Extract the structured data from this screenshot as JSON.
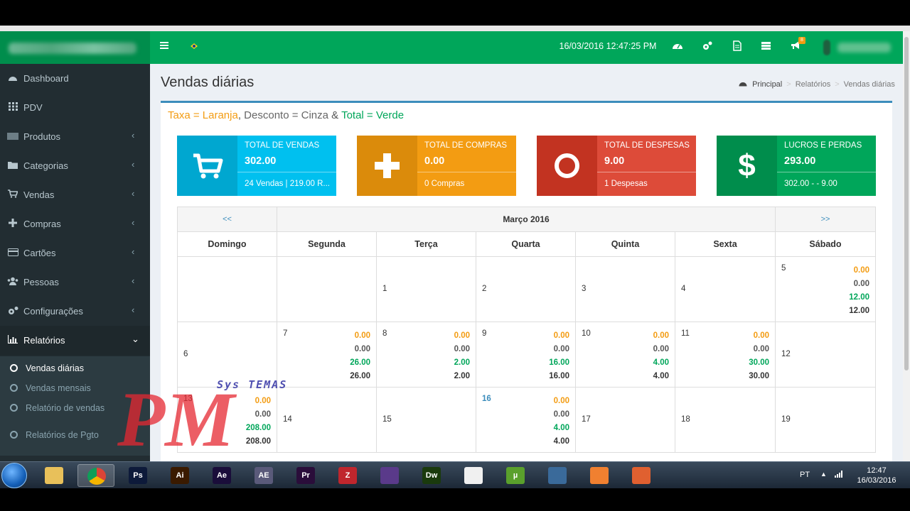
{
  "header": {
    "datetime": "16/03/2016 12:47:25 PM",
    "menu_icon": "hamburger-menu-icon",
    "flag_icon": "brazil-flag-icon",
    "notification_count": "8"
  },
  "sidebar": {
    "items": [
      {
        "label": "Dashboard",
        "icon": "dashboard-icon"
      },
      {
        "label": "PDV",
        "icon": "grid-icon"
      },
      {
        "label": "Produtos",
        "icon": "product-icon"
      },
      {
        "label": "Categorias",
        "icon": "folder-icon"
      },
      {
        "label": "Vendas",
        "icon": "cart-icon"
      },
      {
        "label": "Compras",
        "icon": "plus-icon"
      },
      {
        "label": "Cartões",
        "icon": "credit-card-icon"
      },
      {
        "label": "Pessoas",
        "icon": "users-icon"
      },
      {
        "label": "Configurações",
        "icon": "cogs-icon"
      },
      {
        "label": "Relatórios",
        "icon": "bar-chart-icon"
      }
    ],
    "submenu": [
      {
        "label": "Vendas diárias"
      },
      {
        "label": "Vendas mensais"
      },
      {
        "label": "Relatório de vendas"
      },
      {
        "label": "Relatórios de Pgto"
      }
    ]
  },
  "page": {
    "title": "Vendas diárias",
    "breadcrumb": [
      "Principal",
      "Relatórios",
      "Vendas diárias"
    ],
    "legend": {
      "taxa": "Taxa = Laranja",
      "sep1": ", ",
      "desconto": "Desconto = Cinza",
      "sep2": " & ",
      "total": "Total = Verde"
    }
  },
  "info_boxes": [
    {
      "title": "TOTAL DE VENDAS",
      "value": "302.00",
      "desc": "24 Vendas | 219.00 R...",
      "color": "#00c0ef",
      "icon_bg": "#00a7d0",
      "icon": "cart-icon"
    },
    {
      "title": "TOTAL DE COMPRAS",
      "value": "0.00",
      "desc": "0 Compras",
      "color": "#f39c12",
      "icon_bg": "#db8b0b",
      "icon": "plus-icon"
    },
    {
      "title": "TOTAL DE DESPESAS",
      "value": "9.00",
      "desc": "1 Despesas",
      "color": "#dd4b39",
      "icon_bg": "#c23321",
      "icon": "circle-icon"
    },
    {
      "title": "LUCROS E PERDAS",
      "value": "293.00",
      "desc": "302.00 - - 9.00",
      "color": "#00a65a",
      "icon_bg": "#008d4c",
      "icon": "dollar-icon"
    }
  ],
  "calendar": {
    "prev": "<<",
    "next": ">>",
    "month": "Março 2016",
    "weekdays": [
      "Domingo",
      "Segunda",
      "Terça",
      "Quarta",
      "Quinta",
      "Sexta",
      "Sábado"
    ],
    "weeks": [
      [
        {
          "day": "",
          "vals": null
        },
        {
          "day": "",
          "vals": null
        },
        {
          "day": "1",
          "vals": null
        },
        {
          "day": "2",
          "vals": null
        },
        {
          "day": "3",
          "vals": null
        },
        {
          "day": "4",
          "vals": null
        },
        {
          "day": "5",
          "vals": [
            "0.00",
            "0.00",
            "12.00",
            "12.00"
          ]
        }
      ],
      [
        {
          "day": "6",
          "vals": null
        },
        {
          "day": "7",
          "vals": [
            "0.00",
            "0.00",
            "26.00",
            "26.00"
          ]
        },
        {
          "day": "8",
          "vals": [
            "0.00",
            "0.00",
            "2.00",
            "2.00"
          ]
        },
        {
          "day": "9",
          "vals": [
            "0.00",
            "0.00",
            "16.00",
            "16.00"
          ]
        },
        {
          "day": "10",
          "vals": [
            "0.00",
            "0.00",
            "4.00",
            "4.00"
          ]
        },
        {
          "day": "11",
          "vals": [
            "0.00",
            "0.00",
            "30.00",
            "30.00"
          ]
        },
        {
          "day": "12",
          "vals": null
        }
      ],
      [
        {
          "day": "13",
          "vals": [
            "0.00",
            "0.00",
            "208.00",
            "208.00"
          ]
        },
        {
          "day": "14",
          "vals": null
        },
        {
          "day": "15",
          "vals": null
        },
        {
          "day": "16",
          "vals": [
            "0.00",
            "0.00",
            "4.00",
            "4.00"
          ],
          "today": true
        },
        {
          "day": "17",
          "vals": null
        },
        {
          "day": "18",
          "vals": null
        },
        {
          "day": "19",
          "vals": null
        }
      ]
    ]
  },
  "watermark": {
    "text": "Sys TEMAS",
    "letters": "PM"
  },
  "taskbar": {
    "apps": [
      {
        "name": "explorer",
        "label": "",
        "color": "#e8c05a"
      },
      {
        "name": "chrome",
        "label": "",
        "color": "#dd4b39"
      },
      {
        "name": "photoshop",
        "label": "Ps",
        "color": "#0d1a3a"
      },
      {
        "name": "illustrator",
        "label": "Ai",
        "color": "#3a1a00"
      },
      {
        "name": "after-effects",
        "label": "Ae",
        "color": "#1a0d3a"
      },
      {
        "name": "ae-alt",
        "label": "AE",
        "color": "#5a5a7a"
      },
      {
        "name": "premiere",
        "label": "Pr",
        "color": "#2a0d3a"
      },
      {
        "name": "filezilla",
        "label": "Z",
        "color": "#c0262d"
      },
      {
        "name": "app-purple",
        "label": "",
        "color": "#5a3a8a"
      },
      {
        "name": "dreamweaver",
        "label": "Dw",
        "color": "#1a3a0d"
      },
      {
        "name": "app-grid",
        "label": "",
        "color": "#f0f0f0"
      },
      {
        "name": "utorrent",
        "label": "µ",
        "color": "#5aa02c"
      },
      {
        "name": "app-monitor",
        "label": "",
        "color": "#3a6a9a"
      },
      {
        "name": "xampp",
        "label": "",
        "color": "#f08030"
      },
      {
        "name": "app-paw",
        "label": "",
        "color": "#e06030"
      }
    ],
    "lang": "PT",
    "time": "12:47",
    "date": "16/03/2016"
  }
}
